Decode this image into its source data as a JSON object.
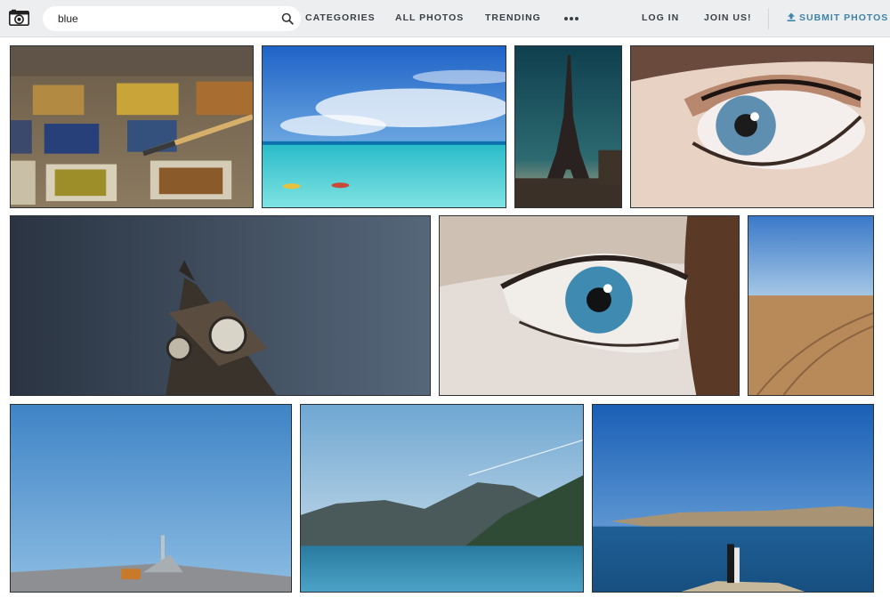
{
  "header": {
    "logo_icon": "camera-icon",
    "search": {
      "value": "blue",
      "placeholder": "",
      "icon": "search-icon"
    },
    "nav": {
      "categories": "CATEGORIES",
      "all_photos": "ALL PHOTOS",
      "trending": "TRENDING",
      "more_icon": "more-dots-icon",
      "login": "LOG IN",
      "join": "JOIN US!",
      "submit": "SUBMIT PHOTOS",
      "submit_icon": "upload-icon"
    },
    "colors": {
      "header_bg": "#eceef0",
      "nav_text": "#3a3f44",
      "accent": "#3e84a8"
    }
  },
  "gallery": {
    "photos": [
      {
        "subject": "watercolor paint palette with brush"
      },
      {
        "subject": "turquoise sea with kayakers under blue sky"
      },
      {
        "subject": "Eiffel Tower at dusk"
      },
      {
        "subject": "close-up of blue eye with eyeshadow"
      },
      {
        "subject": "Big Ben clock tower against dark blue sky"
      },
      {
        "subject": "close-up of blue eye in profile"
      },
      {
        "subject": "sandy beach with tire tracks under blue sky"
      },
      {
        "subject": "highway bridge with car under blue sky"
      },
      {
        "subject": "mountains over blue lake"
      },
      {
        "subject": "couple standing on cliff by blue sea"
      }
    ]
  }
}
